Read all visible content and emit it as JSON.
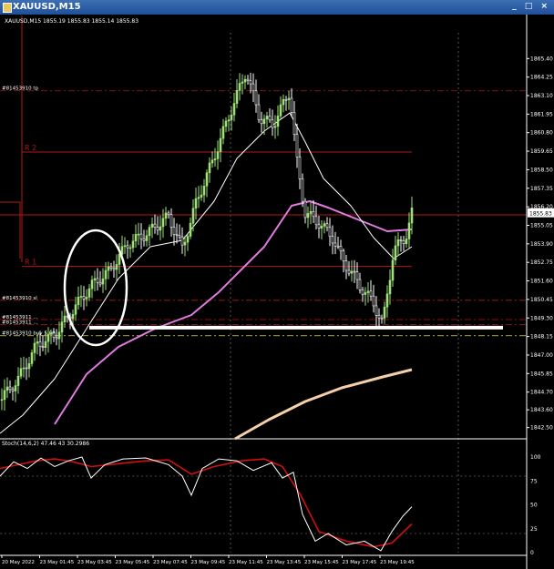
{
  "window": {
    "title": "XAUUSD,M15",
    "controls": "_ □ ×"
  },
  "header": {
    "info": "XAUUSD,M15  1855.19 1855.83 1855.14 1855.83"
  },
  "colors": {
    "candle_bull": "#9ee07a",
    "candle_bear": "#ffffff",
    "ma_fast": "#ffffff",
    "ma_mid": "#e07be0",
    "ma_slow": "#f5cfaa",
    "level_line": "#b01818",
    "stoch_main": "#ffffff",
    "stoch_signal": "#d01010",
    "support": "#ffffff",
    "ellipse": "#ffffff",
    "grid": "#8a8a8a",
    "yellow_line": "#d7d76a",
    "price_tag_bg": "#ffffff"
  },
  "chart_data": [
    {
      "type": "candlestick",
      "symbol": "XAUUSD",
      "timeframe": "M15",
      "ohlc_readout": {
        "open": 1855.19,
        "high": 1855.83,
        "low": 1855.14,
        "close": 1855.83
      },
      "current_price_tag": "1855.83",
      "y_range": [
        1841.8,
        1867.0
      ],
      "price_ticks": [
        "1865.40",
        "1864.25",
        "1863.10",
        "1861.95",
        "1860.80",
        "1859.65",
        "1858.50",
        "1857.35",
        "1856.20",
        "1855.05",
        "1853.90",
        "1852.75",
        "1851.60",
        "1850.45",
        "1849.30",
        "1848.15",
        "1847.00",
        "1845.85",
        "1844.70",
        "1843.60",
        "1842.50"
      ],
      "time_ticks": [
        "20 May 2022",
        "23 May 01:45",
        "23 May 03:45",
        "23 May 05:45",
        "23 May 07:45",
        "23 May 09:45",
        "23 May 11:45",
        "23 May 13:45",
        "23 May 15:45",
        "23 May 17:45",
        "23 May 19:45"
      ],
      "levels": [
        {
          "label": "R 2",
          "value": 1859.6
        },
        {
          "label": "R 1",
          "value": 1852.5
        }
      ],
      "order_lines": [
        {
          "label": "#81453910 tp",
          "value": 1863.4
        },
        {
          "label": "#81453910 sl",
          "value": 1850.4
        },
        {
          "label": "#81453911 ...",
          "value": 1849.2
        },
        {
          "label": "#81453911 ...",
          "value": 1848.9
        },
        {
          "label": "#81453910 buy 5.00",
          "value": 1848.2
        }
      ],
      "support_level": 1848.7,
      "grid": true
    },
    {
      "type": "line",
      "name": "Stoch(14,6,2) 47.46 43 30.2986",
      "y_range": [
        0,
        100
      ],
      "y_ticks": [
        "100",
        "75",
        "50",
        "25",
        "0"
      ],
      "levels": [
        20,
        80
      ]
    }
  ]
}
